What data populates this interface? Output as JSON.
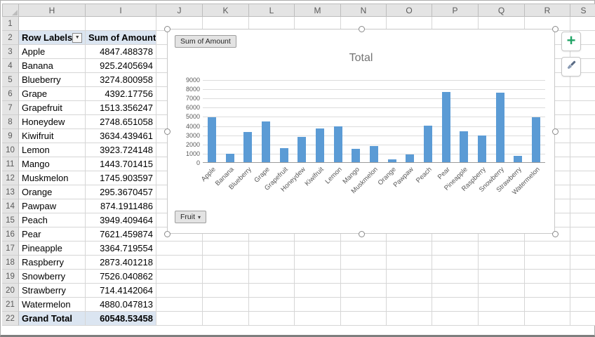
{
  "spreadsheet": {
    "column_headers": [
      "H",
      "I",
      "J",
      "K",
      "L",
      "M",
      "N",
      "O",
      "P",
      "Q",
      "R",
      "S"
    ],
    "visible_rows": 22
  },
  "pivot_table": {
    "row_labels_header": "Row Labels",
    "value_header": "Sum of Amount",
    "rows": [
      {
        "label": "Apple",
        "value": "4847.488378"
      },
      {
        "label": "Banana",
        "value": "925.2405694"
      },
      {
        "label": "Blueberry",
        "value": "3274.800958"
      },
      {
        "label": "Grape",
        "value": "4392.17756"
      },
      {
        "label": "Grapefruit",
        "value": "1513.356247"
      },
      {
        "label": "Honeydew",
        "value": "2748.651058"
      },
      {
        "label": "Kiwifruit",
        "value": "3634.439461"
      },
      {
        "label": "Lemon",
        "value": "3923.724148"
      },
      {
        "label": "Mango",
        "value": "1443.701415"
      },
      {
        "label": "Muskmelon",
        "value": "1745.903597"
      },
      {
        "label": "Orange",
        "value": "295.3670457"
      },
      {
        "label": "Pawpaw",
        "value": "874.1911486"
      },
      {
        "label": "Peach",
        "value": "3949.409464"
      },
      {
        "label": "Pear",
        "value": "7621.459874"
      },
      {
        "label": "Pineapple",
        "value": "3364.719554"
      },
      {
        "label": "Raspberry",
        "value": "2873.401218"
      },
      {
        "label": "Snowberry",
        "value": "7526.040862"
      },
      {
        "label": "Strawberry",
        "value": "714.4142064"
      },
      {
        "label": "Watermelon",
        "value": "4880.047813"
      }
    ],
    "grand_total": {
      "label": "Grand Total",
      "value": "60548.53458"
    }
  },
  "chart": {
    "value_field_button": "Sum of Amount",
    "axis_field_button": "Fruit",
    "bar_color": "#5B9BD5"
  },
  "chart_data": {
    "type": "bar",
    "title": "Total",
    "categories": [
      "Apple",
      "Banana",
      "Blueberry",
      "Grape",
      "Grapefruit",
      "Honeydew",
      "Kiwifruit",
      "Lemon",
      "Mango",
      "Muskmelon",
      "Orange",
      "Pawpaw",
      "Peach",
      "Pear",
      "Pineapple",
      "Raspberry",
      "Snowberry",
      "Strawberry",
      "Watermelon"
    ],
    "values": [
      4847.488378,
      925.2405694,
      3274.800958,
      4392.17756,
      1513.356247,
      2748.651058,
      3634.439461,
      3923.724148,
      1443.701415,
      1745.903597,
      295.3670457,
      874.1911486,
      3949.409464,
      7621.459874,
      3364.719554,
      2873.401218,
      7526.040862,
      714.4142064,
      4880.047813
    ],
    "ylim": [
      0,
      9000
    ],
    "yticks": [
      0,
      1000,
      2000,
      3000,
      4000,
      5000,
      6000,
      7000,
      8000,
      9000
    ],
    "legend": "none",
    "grid": true
  },
  "chart_tools": {
    "plus_button": "+"
  }
}
